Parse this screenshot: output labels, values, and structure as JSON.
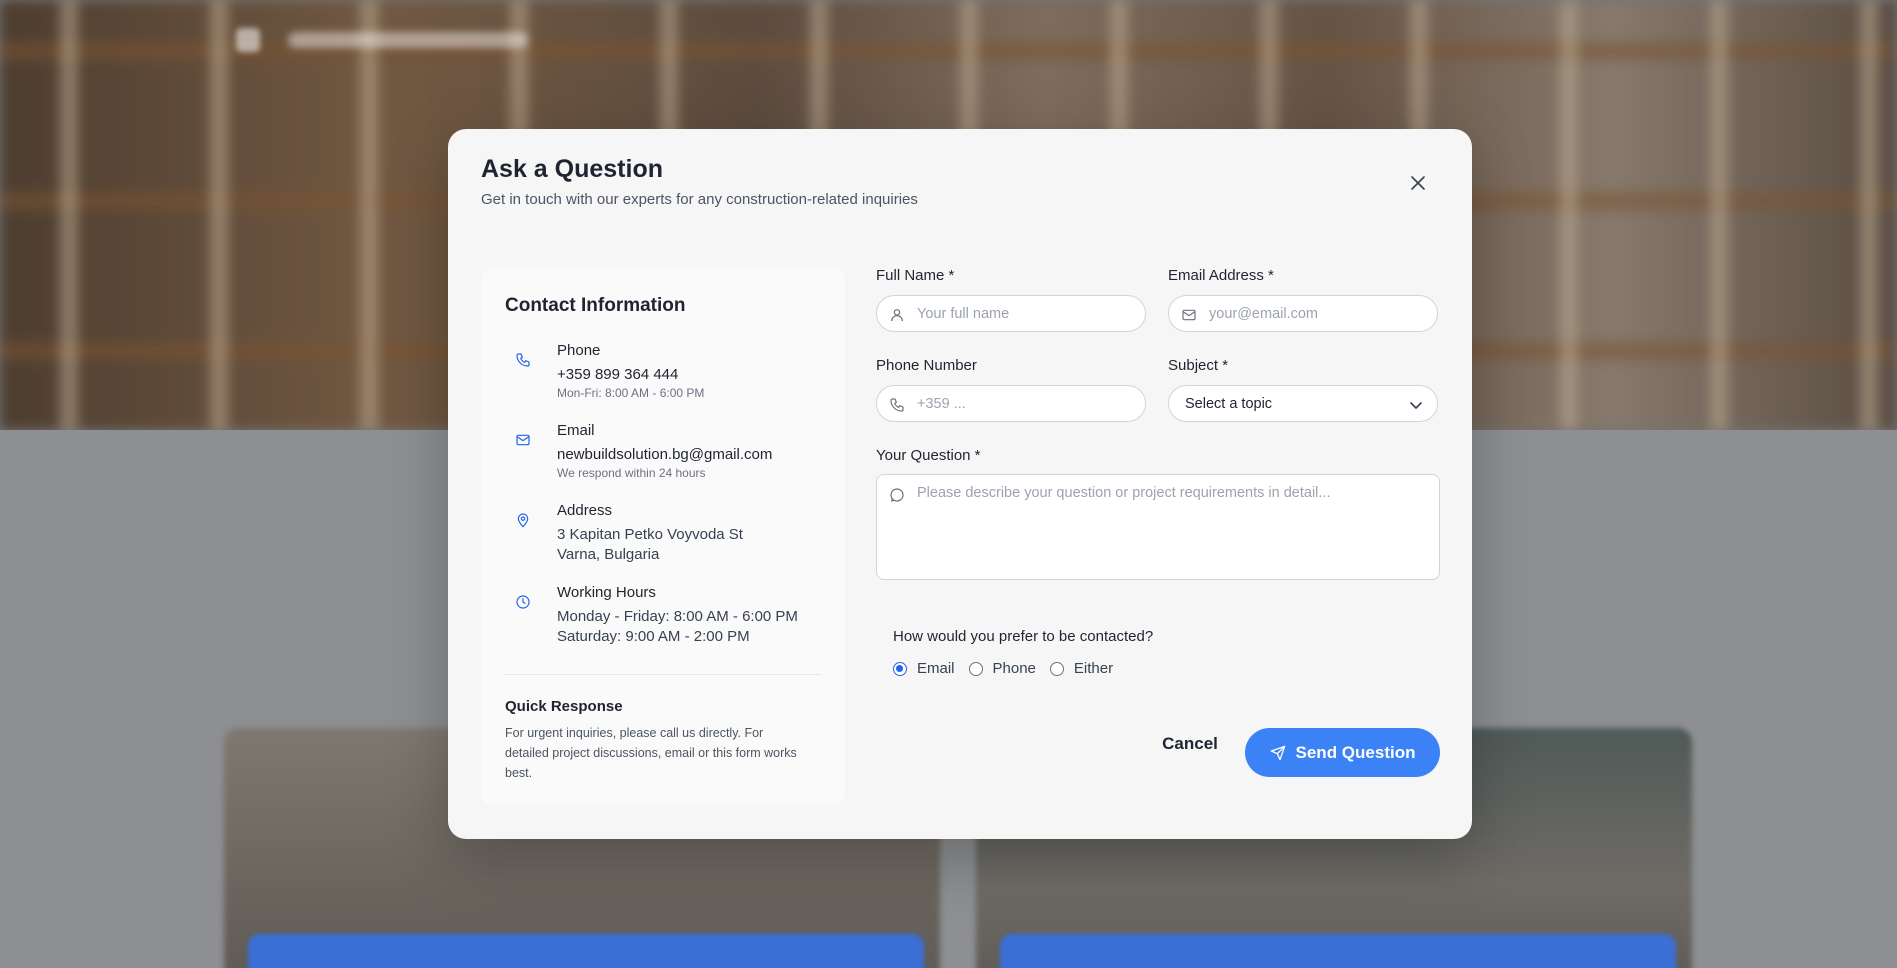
{
  "modal": {
    "title": "Ask a Question",
    "subtitle": "Get in touch with our experts for any construction-related inquiries",
    "close_icon": "close-icon"
  },
  "contact_info": {
    "title": "Contact Information",
    "items": [
      {
        "icon": "phone-icon",
        "label": "Phone",
        "value": "+359 899 364 444",
        "note": "Mon-Fri: 8:00 AM - 6:00 PM"
      },
      {
        "icon": "mail-icon",
        "label": "Email",
        "value": "newbuildsolution.bg@gmail.com",
        "note": "We respond within 24 hours"
      },
      {
        "icon": "map-pin-icon",
        "label": "Address",
        "value": "3 Kapitan Petko Voyvoda St",
        "value2": "Varna, Bulgaria"
      },
      {
        "icon": "clock-icon",
        "label": "Working Hours",
        "value": "Monday - Friday: 8:00 AM - 6:00 PM",
        "value2": "Saturday: 9:00 AM - 2:00 PM"
      }
    ],
    "quick_response": {
      "title": "Quick Response",
      "text": "For urgent inquiries, please call us directly. For detailed project discussions, email or this form works best."
    }
  },
  "form": {
    "full_name": {
      "label": "Full Name *",
      "placeholder": "Your full name",
      "icon": "user-icon"
    },
    "email": {
      "label": "Email Address *",
      "placeholder": "your@email.com",
      "icon": "mail-icon"
    },
    "phone": {
      "label": "Phone Number",
      "placeholder": "+359 ...",
      "icon": "phone-icon"
    },
    "subject": {
      "label": "Subject *",
      "selected": "Select a topic",
      "icon": "chevron-down-icon"
    },
    "question": {
      "label": "Your Question *",
      "placeholder": "Please describe your question or project requirements in detail...",
      "icon": "message-circle-icon"
    },
    "contact_preference": {
      "question": "How would you prefer to be contacted?",
      "options": [
        "Email",
        "Phone",
        "Either"
      ],
      "selected": "Email"
    },
    "cancel_label": "Cancel",
    "submit_label": "Send Question",
    "submit_icon": "send-icon"
  },
  "colors": {
    "accent": "#3b82f6",
    "icon_blue": "#2563eb",
    "modal_bg": "#f6f6f6"
  }
}
